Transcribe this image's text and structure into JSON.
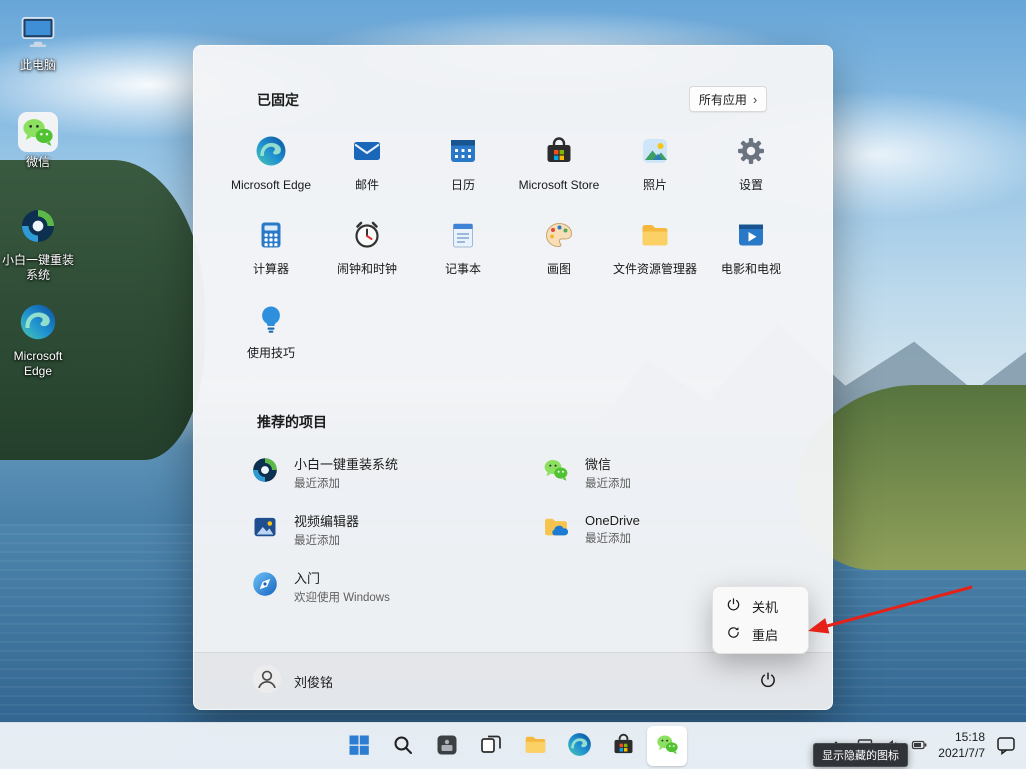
{
  "desktop": {
    "icons": [
      {
        "label": "此电脑",
        "icon": "this-pc-icon"
      },
      {
        "label": "微信",
        "icon": "wechat-icon"
      },
      {
        "label": "小白一键重装系统",
        "icon": "xiaobai-reinstall-icon"
      },
      {
        "label": "Microsoft Edge",
        "icon": "edge-icon"
      }
    ]
  },
  "start_menu": {
    "pinned_header": "已固定",
    "all_apps_button": "所有应用",
    "pinned": [
      {
        "label": "Microsoft Edge",
        "icon": "edge-icon"
      },
      {
        "label": "邮件",
        "icon": "mail-icon"
      },
      {
        "label": "日历",
        "icon": "calendar-icon"
      },
      {
        "label": "Microsoft Store",
        "icon": "store-icon"
      },
      {
        "label": "照片",
        "icon": "photos-icon"
      },
      {
        "label": "设置",
        "icon": "settings-gear-icon"
      },
      {
        "label": "计算器",
        "icon": "calculator-icon"
      },
      {
        "label": "闹钟和时钟",
        "icon": "alarm-clock-icon"
      },
      {
        "label": "记事本",
        "icon": "notepad-icon"
      },
      {
        "label": "画图",
        "icon": "paint-icon"
      },
      {
        "label": "文件资源管理器",
        "icon": "file-explorer-icon"
      },
      {
        "label": "电影和电视",
        "icon": "movies-tv-icon"
      },
      {
        "label": "使用技巧",
        "icon": "tips-icon"
      }
    ],
    "recommended_header": "推荐的项目",
    "recommended": [
      {
        "title": "小白一键重装系统",
        "subtitle": "最近添加",
        "icon": "xiaobai-reinstall-icon"
      },
      {
        "title": "微信",
        "subtitle": "最近添加",
        "icon": "wechat-icon"
      },
      {
        "title": "视频编辑器",
        "subtitle": "最近添加",
        "icon": "video-editor-icon"
      },
      {
        "title": "OneDrive",
        "subtitle": "最近添加",
        "icon": "onedrive-icon"
      },
      {
        "title": "入门",
        "subtitle": "欢迎使用 Windows",
        "icon": "get-started-icon"
      }
    ],
    "user_name": "刘俊铭"
  },
  "power_menu": {
    "shutdown": "关机",
    "restart": "重启"
  },
  "taskbar": {
    "tray": {
      "time": "15:18",
      "date": "2021/7/7",
      "hidden_icons_tooltip": "显示隐藏的图标"
    }
  }
}
